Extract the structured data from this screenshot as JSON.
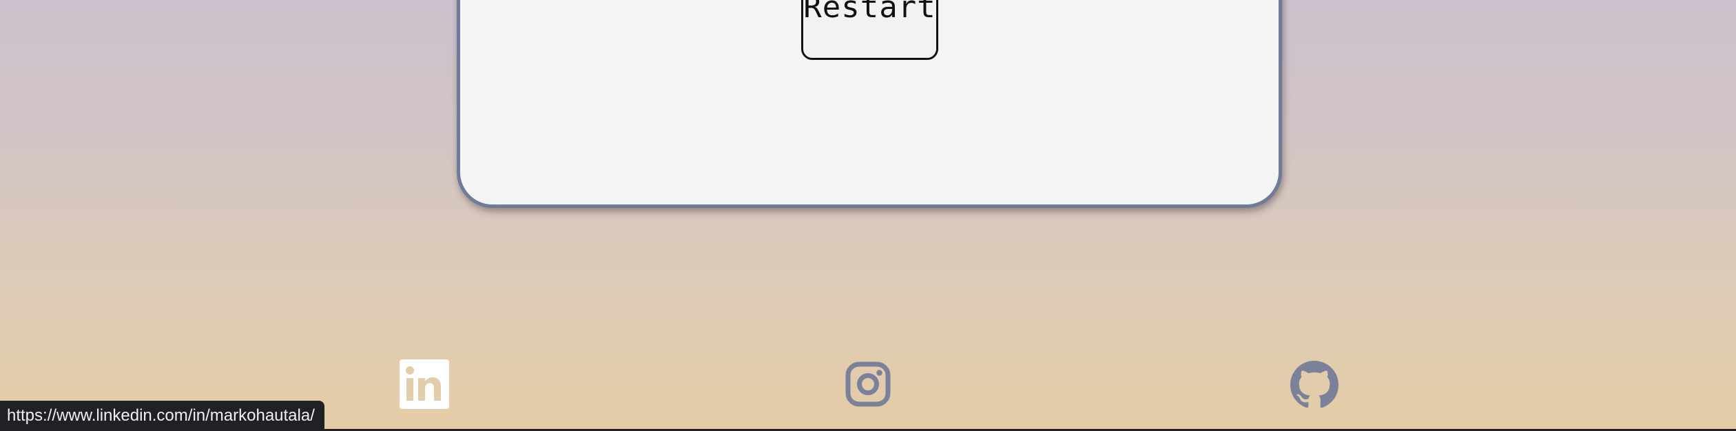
{
  "card": {
    "restart_label": "Restart"
  },
  "social": {
    "items": [
      {
        "name": "linkedin",
        "icon": "linkedin-icon",
        "color": "#ffffff"
      },
      {
        "name": "instagram",
        "icon": "instagram-icon",
        "color": "#7a8199"
      },
      {
        "name": "github",
        "icon": "github-icon",
        "color": "#7a8199"
      }
    ]
  },
  "status_bar": {
    "url": "https://www.linkedin.com/in/markohautala/"
  },
  "colors": {
    "card_border": "#6f7b99",
    "card_background": "#f5f4f5",
    "status_bar_background": "#202124"
  }
}
